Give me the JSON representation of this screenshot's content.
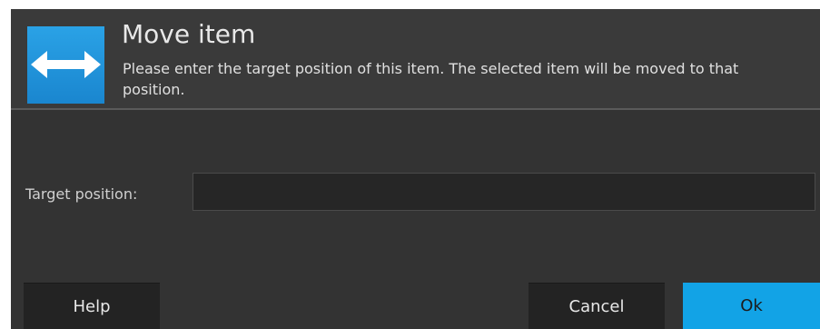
{
  "dialog": {
    "title": "Move item",
    "description": "Please enter the target position of this item. The selected item will be moved to that position.",
    "icon": "horizontal-double-arrow-icon",
    "accent_color": "#12a3e6",
    "background_color": "#333333"
  },
  "form": {
    "target_position_label": "Target position:",
    "target_position_value": ""
  },
  "buttons": {
    "help_label": "Help",
    "cancel_label": "Cancel",
    "ok_label": "Ok"
  }
}
